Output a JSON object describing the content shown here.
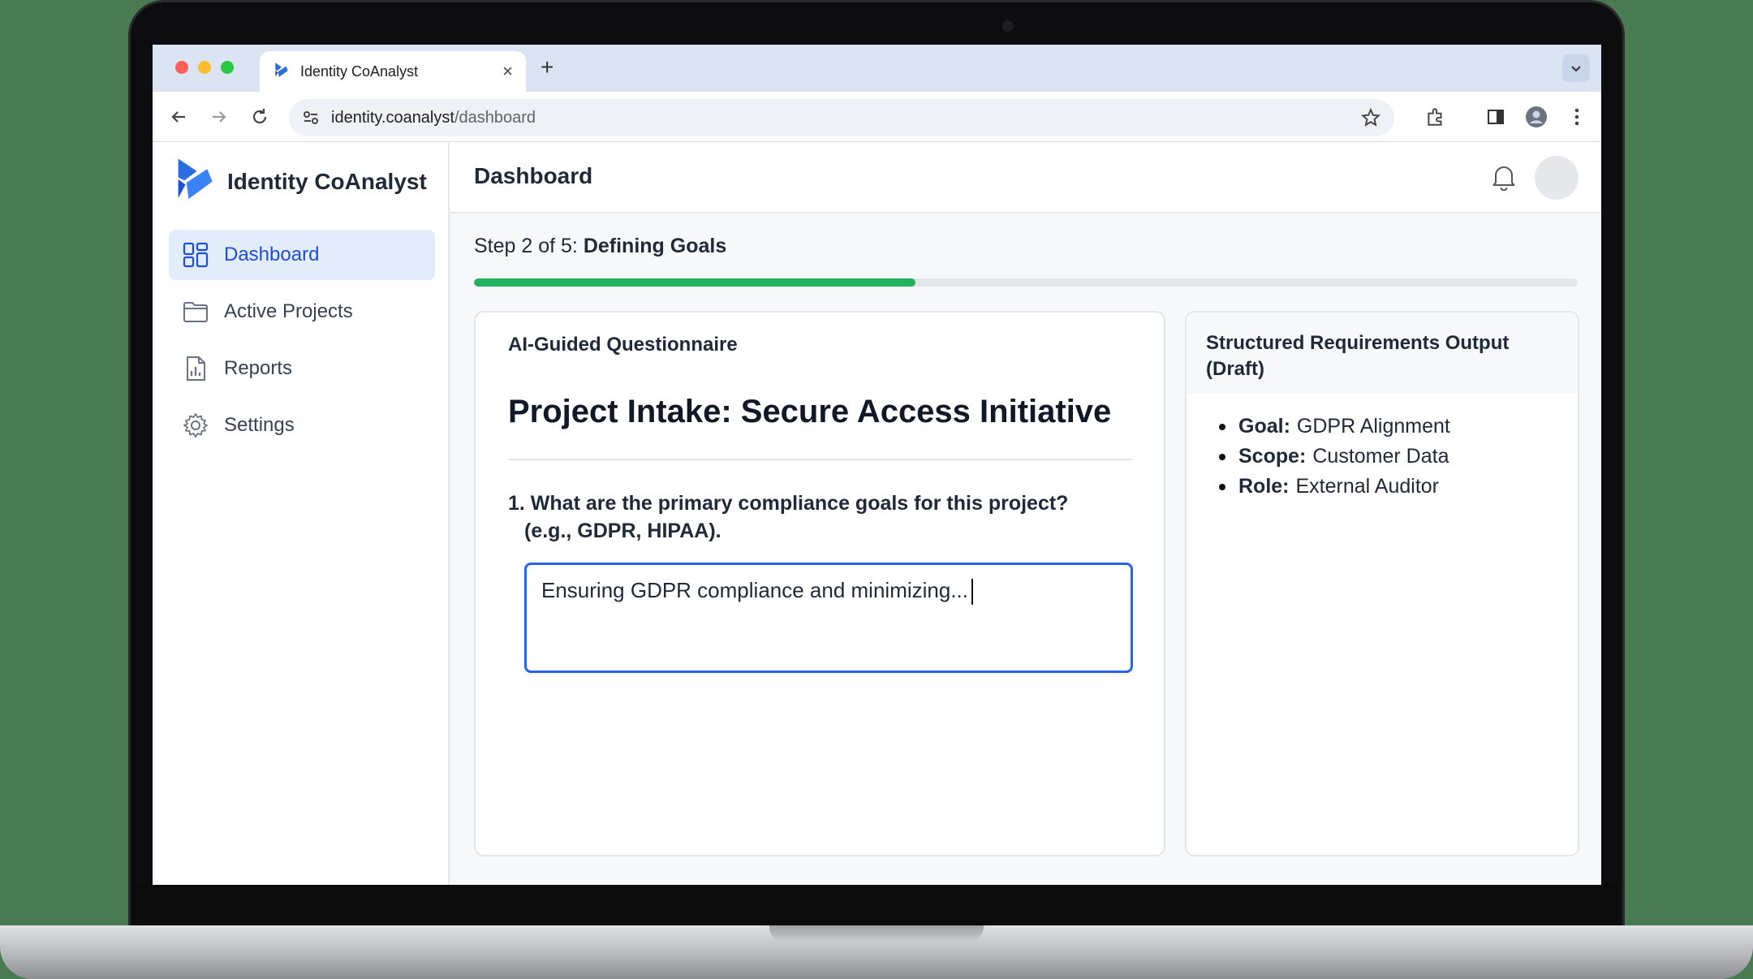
{
  "browser": {
    "tab_title": "Identity CoAnalyst",
    "new_tab": "+",
    "tab_close": "×",
    "url_host": "identity.coanalyst",
    "url_path": "/dashboard"
  },
  "app": {
    "brand": "Identity CoAnalyst",
    "accent_color": "#2563eb",
    "progress_color": "#22b35e"
  },
  "sidebar": {
    "items": [
      {
        "label": "Dashboard",
        "icon": "dashboard-grid-icon",
        "active": true
      },
      {
        "label": "Active Projects",
        "icon": "folder-icon",
        "active": false
      },
      {
        "label": "Reports",
        "icon": "report-document-icon",
        "active": false
      },
      {
        "label": "Settings",
        "icon": "gear-icon",
        "active": false
      }
    ]
  },
  "header": {
    "title": "Dashboard"
  },
  "step": {
    "prefix": "Step 2 of 5:",
    "name": "Defining Goals",
    "progress_fraction": 0.4
  },
  "questionnaire": {
    "label": "AI-Guided Questionnaire",
    "title": "Project Intake: Secure Access Initiative",
    "question_line1": "1. What are the primary compliance goals for this project?",
    "question_line2": "(e.g., GDPR, HIPAA).",
    "answer_value": "Ensuring GDPR compliance and minimizing..."
  },
  "output": {
    "title": "Structured Requirements Output (Draft)",
    "items": [
      {
        "key": "Goal:",
        "value": "GDPR Alignment"
      },
      {
        "key": "Scope:",
        "value": "Customer Data"
      },
      {
        "key": "Role:",
        "value": "External Auditor"
      }
    ]
  }
}
